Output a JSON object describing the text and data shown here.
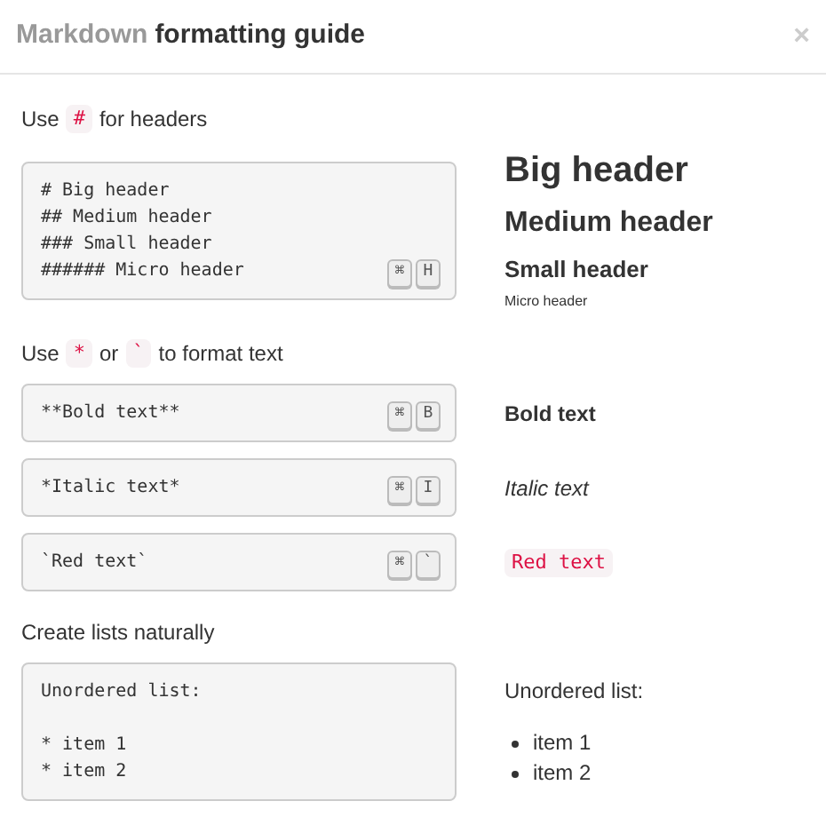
{
  "dialog": {
    "title_prefix": "Markdown",
    "title": "formatting guide",
    "close": "×"
  },
  "sections": [
    {
      "heading": [
        {
          "kind": "text",
          "text": "Use"
        },
        {
          "kind": "code",
          "text": "#"
        },
        {
          "kind": "text",
          "text": "for headers"
        }
      ],
      "examples": [
        {
          "code": [
            [
              "# Big header",
              "## Medium header",
              "### Small header",
              "###### Micro header"
            ]
          ],
          "keys": [
            "⌘",
            "H"
          ],
          "preview": [
            {
              "kind": "h1",
              "text": "Big header"
            },
            {
              "kind": "h2",
              "text": "Medium header"
            },
            {
              "kind": "h3",
              "text": "Small header"
            },
            {
              "kind": "h6",
              "text": "Micro header"
            }
          ]
        }
      ]
    },
    {
      "heading": [
        {
          "kind": "text",
          "text": "Use"
        },
        {
          "kind": "code",
          "text": "*"
        },
        {
          "kind": "text",
          "text": "or"
        },
        {
          "kind": "code",
          "text": "`"
        },
        {
          "kind": "text",
          "text": "to format text"
        }
      ],
      "examples": [
        {
          "code": [
            [
              "**Bold text**"
            ]
          ],
          "keys": [
            "⌘",
            "B"
          ],
          "preview": [
            {
              "kind": "bold",
              "text": "Bold text"
            }
          ]
        },
        {
          "code": [
            [
              "*Italic text*"
            ]
          ],
          "keys": [
            "⌘",
            "I"
          ],
          "preview": [
            {
              "kind": "italic",
              "text": "Italic text"
            }
          ]
        },
        {
          "code": [
            [
              "`Red text`"
            ]
          ],
          "keys": [
            "⌘",
            "`"
          ],
          "preview": [
            {
              "kind": "red",
              "text": "Red text"
            }
          ]
        }
      ]
    },
    {
      "heading": [
        {
          "kind": "text",
          "text": "Create lists naturally"
        }
      ],
      "examples": [
        {
          "code": [
            [
              "Unordered list:"
            ],
            [
              "* item 1",
              "* item 2"
            ]
          ],
          "preview": [
            {
              "kind": "para",
              "text": "Unordered list:"
            },
            {
              "kind": "bullet",
              "text": "item 1"
            },
            {
              "kind": "bullet",
              "text": "item 2"
            }
          ]
        }
      ]
    }
  ]
}
